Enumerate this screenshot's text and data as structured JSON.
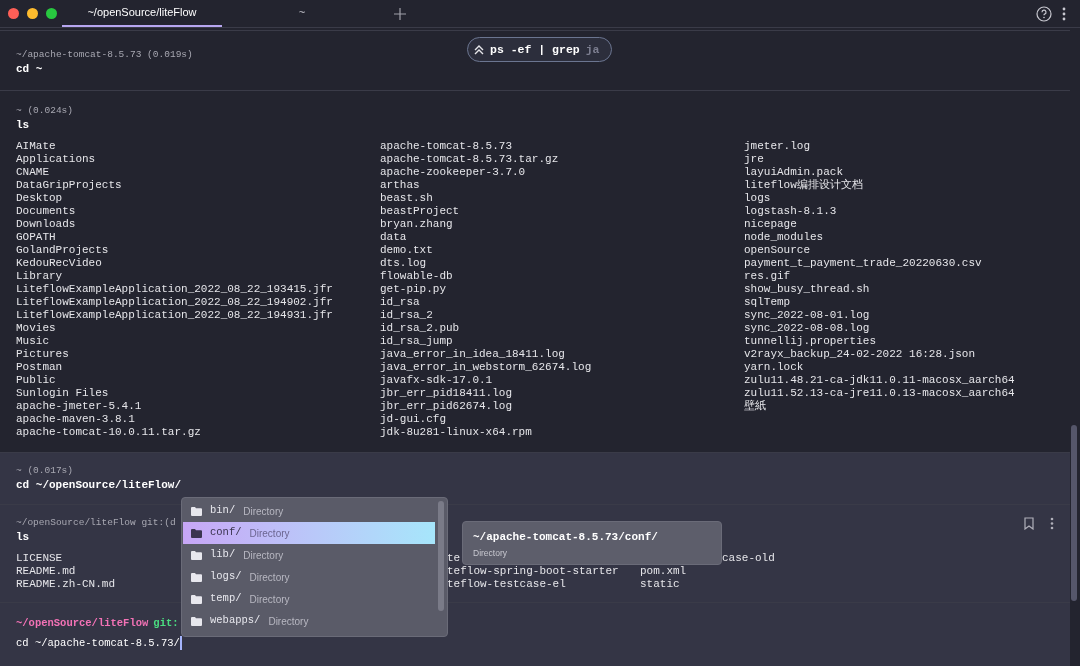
{
  "tabs": [
    {
      "label": "~/openSource/liteFlow",
      "selected": true
    },
    {
      "label": "~",
      "selected": false
    }
  ],
  "history_search": {
    "query": "ps -ef | grep",
    "suggestion": "ja"
  },
  "blocks": [
    {
      "header": "~/apache-tomcat-8.5.73 (0.019s)",
      "command": "cd ~"
    },
    {
      "header": "~ (0.024s)",
      "command": "ls",
      "columns": [
        [
          "AIMate",
          "Applications",
          "CNAME",
          "DataGripProjects",
          "Desktop",
          "Documents",
          "Downloads",
          "GOPATH",
          "GolandProjects",
          "KedouRecVideo",
          "Library",
          "LiteflowExampleApplication_2022_08_22_193415.jfr",
          "LiteflowExampleApplication_2022_08_22_194902.jfr",
          "LiteflowExampleApplication_2022_08_22_194931.jfr",
          "Movies",
          "Music",
          "Pictures",
          "Postman",
          "Public",
          "Sunlogin Files",
          "apache-jmeter-5.4.1",
          "apache-maven-3.8.1",
          "apache-tomcat-10.0.11.tar.gz"
        ],
        [
          "apache-tomcat-8.5.73",
          "apache-tomcat-8.5.73.tar.gz",
          "apache-zookeeper-3.7.0",
          "arthas",
          "beast.sh",
          "beastProject",
          "bryan.zhang",
          "data",
          "demo.txt",
          "dts.log",
          "flowable-db",
          "get-pip.py",
          "id_rsa",
          "id_rsa_2",
          "id_rsa_2.pub",
          "id_rsa_jump",
          "java_error_in_idea_18411.log",
          "java_error_in_webstorm_62674.log",
          "javafx-sdk-17.0.1",
          "jbr_err_pid18411.log",
          "jbr_err_pid62674.log",
          "jd-gui.cfg",
          "jdk-8u281-linux-x64.rpm"
        ],
        [
          "jmeter.log",
          "jre",
          "layuiAdmin.pack",
          "liteflow编排设计文档",
          "logs",
          "logstash-8.1.3",
          "nicepage",
          "node_modules",
          "openSource",
          "payment_t_payment_trade_20220630.csv",
          "res.gif",
          "show_busy_thread.sh",
          "sqlTemp",
          "sync_2022-08-01.log",
          "sync_2022-08-08.log",
          "tunnellij.properties",
          "v2rayx_backup_24-02-2022 16:28.json",
          "yarn.lock",
          "zulu11.48.21-ca-jdk11.0.11-macosx_aarch64",
          "zulu11.52.13-ca-jre11.0.13-macosx_aarch64",
          "壁紙"
        ]
      ]
    },
    {
      "header": "~ (0.017s)",
      "command": "cd ~/openSource/liteFlow/"
    },
    {
      "header": "~/openSource/liteFlow git:(d",
      "command": "ls",
      "columns": [
        [
          "LICENSE",
          "README.md",
          "README.zh-CN.md"
        ],
        [
          "te",
          "teflow-spring-boot-starter",
          "teflow-testcase-el"
        ],
        [
          "case-old",
          "pom.xml",
          "static"
        ]
      ]
    }
  ],
  "prompt": {
    "path": "~/openSource/liteFlow",
    "git": "git:",
    "input": "cd ~/apache-tomcat-8.5.73/"
  },
  "completion": {
    "items": [
      {
        "name": "bin/",
        "type": "Directory",
        "selected": false
      },
      {
        "name": "conf/",
        "type": "Directory",
        "selected": true
      },
      {
        "name": "lib/",
        "type": "Directory",
        "selected": false
      },
      {
        "name": "logs/",
        "type": "Directory",
        "selected": false
      },
      {
        "name": "temp/",
        "type": "Directory",
        "selected": false
      },
      {
        "name": "webapps/",
        "type": "Directory",
        "selected": false
      }
    ],
    "detail": {
      "path": "~/apache-tomcat-8.5.73/conf/",
      "type": "Directory"
    }
  }
}
